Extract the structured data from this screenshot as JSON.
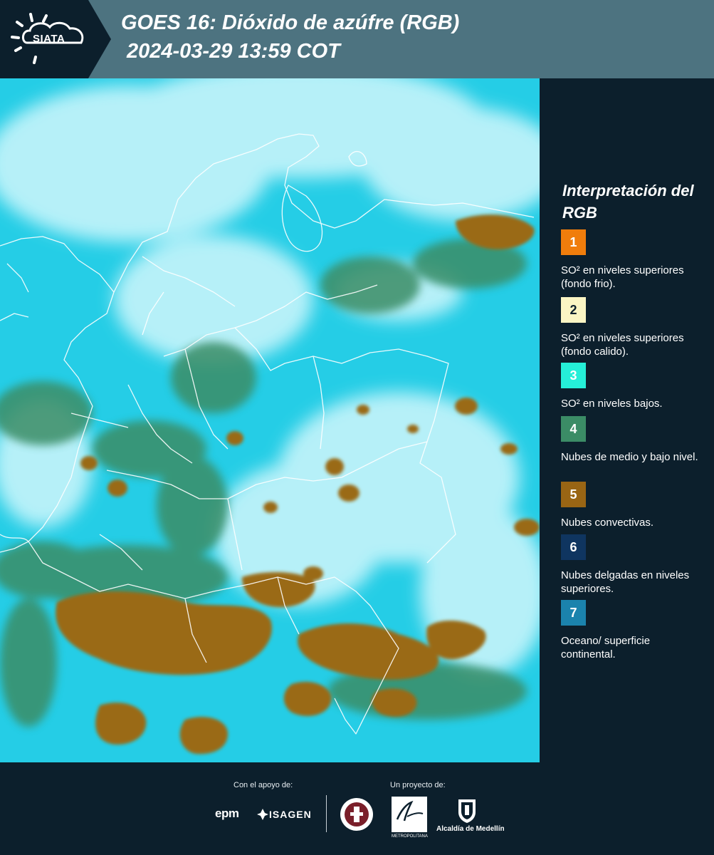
{
  "header": {
    "logo_text": "SIATA",
    "title_line1": "GOES 16: Dióxido de azúfre (RGB)",
    "title_line2": "2024-03-29 13:59 COT"
  },
  "map": {
    "ocean_color": "#25cde6",
    "cloud_color": "#c8f6fb",
    "convective_color": "#9a6a16",
    "mid_low_color": "#3a8d66",
    "border_color": "#ffffff"
  },
  "legend": {
    "title": "Interpretación del RGB",
    "items": [
      {
        "number": "1",
        "color": "#f07d0c",
        "label": "SO² en niveles superiores (fondo frio)."
      },
      {
        "number": "2",
        "color": "#fbf5c4",
        "label": "SO² en niveles superiores (fondo calido)."
      },
      {
        "number": "3",
        "color": "#25efd8",
        "label": "SO² en niveles bajos."
      },
      {
        "number": "4",
        "color": "#3b8c66",
        "label": "Nubes de medio y bajo nivel."
      },
      {
        "number": "5",
        "color": "#996514",
        "label": "Nubes convectivas."
      },
      {
        "number": "6",
        "color": "#0f3560",
        "label": "Nubes delgadas en niveles superiores."
      },
      {
        "number": "7",
        "color": "#1b83ad",
        "label": "Oceano/ superficie continental."
      }
    ]
  },
  "footer": {
    "support_caption": "Con el apoyo de:",
    "project_caption": "Un proyecto de:",
    "epm": "epm",
    "isagen": "ISAGEN",
    "area_metro": "METROPOLITANA",
    "alcaldia": "Alcaldía de Medellín"
  }
}
